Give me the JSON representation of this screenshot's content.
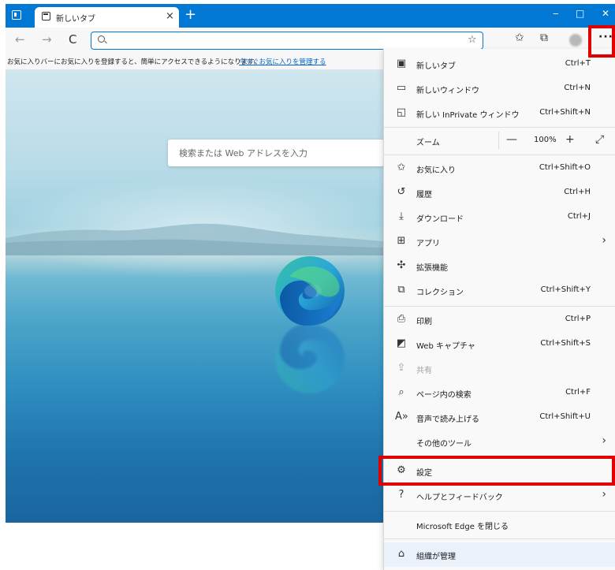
{
  "tab": {
    "title": "新しいタブ",
    "close": "×",
    "new": "+"
  },
  "window": {
    "minimize": "‒",
    "maximize": "□",
    "close": "✕"
  },
  "toolbar": {
    "back": "←",
    "forward": "→",
    "refresh": "C",
    "more": "···"
  },
  "address": {
    "placeholder": ""
  },
  "favbar": {
    "message": "お気に入りバーにお気に入りを登録すると、簡単にアクセスできるようになります。",
    "link": "今すぐお気に入りを管理する"
  },
  "search": {
    "placeholder": "検索または Web アドレスを入力"
  },
  "menu": {
    "new_tab": {
      "label": "新しいタブ",
      "shortcut": "Ctrl+T"
    },
    "new_window": {
      "label": "新しいウィンドウ",
      "shortcut": "Ctrl+N"
    },
    "new_inprivate": {
      "label": "新しい InPrivate ウィンドウ",
      "shortcut": "Ctrl+Shift+N"
    },
    "zoom": {
      "label": "ズーム",
      "minus": "—",
      "value": "100%",
      "plus": "+",
      "fullscreen": "⤢"
    },
    "favorites": {
      "label": "お気に入り",
      "shortcut": "Ctrl+Shift+O"
    },
    "history": {
      "label": "履歴",
      "shortcut": "Ctrl+H"
    },
    "downloads": {
      "label": "ダウンロード",
      "shortcut": "Ctrl+J"
    },
    "apps": {
      "label": "アプリ",
      "arrow": "›"
    },
    "extensions": {
      "label": "拡張機能"
    },
    "collections": {
      "label": "コレクション",
      "shortcut": "Ctrl+Shift+Y"
    },
    "print": {
      "label": "印刷",
      "shortcut": "Ctrl+P"
    },
    "web_capture": {
      "label": "Web キャプチャ",
      "shortcut": "Ctrl+Shift+S"
    },
    "share": {
      "label": "共有"
    },
    "find": {
      "label": "ページ内の検索",
      "shortcut": "Ctrl+F"
    },
    "read_aloud": {
      "label": "音声で読み上げる",
      "shortcut": "Ctrl+Shift+U"
    },
    "more_tools": {
      "label": "その他のツール",
      "arrow": "›"
    },
    "settings": {
      "label": "設定"
    },
    "help": {
      "label": "ヘルプとフィードバック",
      "arrow": "›"
    },
    "close_edge": {
      "label": "Microsoft Edge を閉じる"
    },
    "managed": {
      "label": "組織が管理"
    }
  },
  "colors": {
    "accent": "#0078d4",
    "highlight": "#e00000",
    "link": "#0066cc"
  }
}
